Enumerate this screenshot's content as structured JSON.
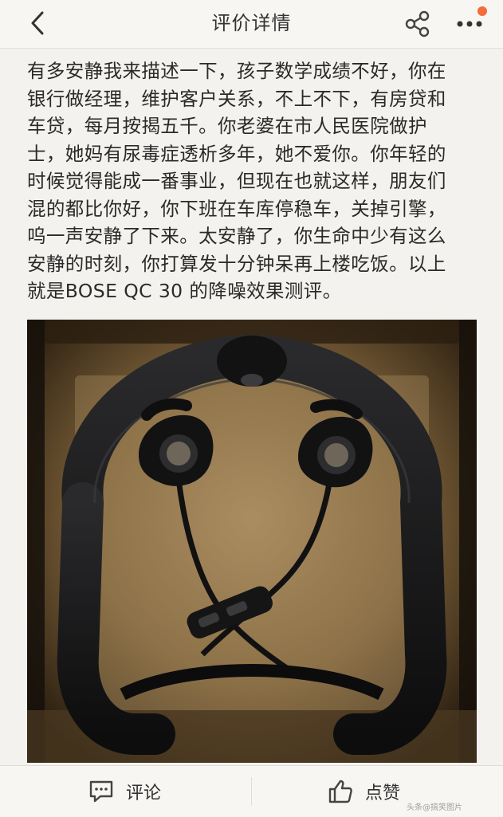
{
  "header": {
    "title": "评价详情",
    "back_icon": "chevron-left-icon",
    "share_icon": "share-icon",
    "more_icon": "more-dots-icon",
    "badge_color": "#f26d3d"
  },
  "review": {
    "lines": [
      "有多安静我来描述一下，孩子数学成绩不好，你在",
      "银行做经理，维护客户关系，不上不下，有房贷和",
      "车贷，每月按揭五千。你老婆在市人民医院做护",
      "士，她妈有尿毒症透析多年，她不爱你。你年轻的",
      "时候觉得能成一番事业，但现在也就这样，朋友们",
      "混的都比你好，你下班在车库停稳车，关掉引擎，",
      "呜一声安静了下来。太安静了，你生命中少有这么",
      "安静的时刻，你打算发十分钟呆再上楼吃饭。以上",
      "就是BOSE QC 30 的降噪效果测评。"
    ]
  },
  "photo": {
    "subject": "BOSE QC 30 neckband earphones in box"
  },
  "bottom_bar": {
    "comment_label": "评论",
    "comment_icon": "comment-icon",
    "like_label": "点赞",
    "like_icon": "thumbs-up-icon"
  },
  "watermark": "头条@搞笑图片"
}
